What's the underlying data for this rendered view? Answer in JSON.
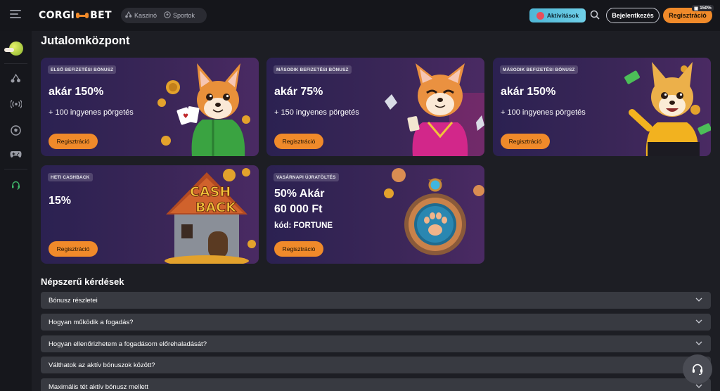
{
  "header": {
    "logo_text_left": "CORGI",
    "logo_text_right": "BET",
    "nav": [
      {
        "label": "Kaszinó",
        "icon": "cherries-icon"
      },
      {
        "label": "Sportok",
        "icon": "soccer-ball-icon"
      }
    ],
    "activity_label": "Aktivitások",
    "login_label": "Bejelentkezés",
    "register_label": "Regisztráció",
    "register_badge": "150%"
  },
  "sidebar": {
    "items": [
      "bonus-ball-icon",
      "cherries-icon",
      "live-broadcast-icon",
      "soccer-ball-icon",
      "gamepad-icon",
      "headset-icon"
    ]
  },
  "main": {
    "title": "Jutalomközpont",
    "cards": [
      {
        "tag": "ELSŐ BEFIZETÉSI BÓNUSZ",
        "headline": "akár 150%",
        "sub": "+ 100 ingyenes pörgetés",
        "cta": "Regisztráció"
      },
      {
        "tag": "MÁSODIK BEFIZETÉSI BÓNUSZ",
        "headline": "akár 75%",
        "sub": "+ 150 ingyenes pörgetés",
        "cta": "Regisztráció"
      },
      {
        "tag": "MÁSODIK BEFIZETÉSI BÓNUSZ",
        "headline": "akár 150%",
        "sub": "+ 100 ingyenes pörgetés",
        "cta": "Regisztráció"
      },
      {
        "tag": "HETI CASHBACK",
        "headline": "15%",
        "cta": "Regisztráció",
        "art_text_1": "CASH",
        "art_text_2": "BACK"
      },
      {
        "tag": "VASÁRNAPI ÚJRATÖLTÉS",
        "headline_line1": "50% Akár",
        "headline_line2": "60 000 Ft",
        "code": "kód: FORTUNE",
        "cta": "Regisztráció"
      }
    ],
    "faq_title": "Népszerű kérdések",
    "faq": [
      "Bónusz részletei",
      "Hogyan működik a fogadás?",
      "Hogyan ellenőrizhetem a fogadásom előrehaladását?",
      "Válthatok az aktív bónuszok között?",
      "Maximális tét aktív bónusz mellett"
    ]
  },
  "colors": {
    "accent": "#f08a2a",
    "activity": "#5cc3de",
    "card_bg": "#2b2151",
    "faq_bg": "#383a41"
  }
}
